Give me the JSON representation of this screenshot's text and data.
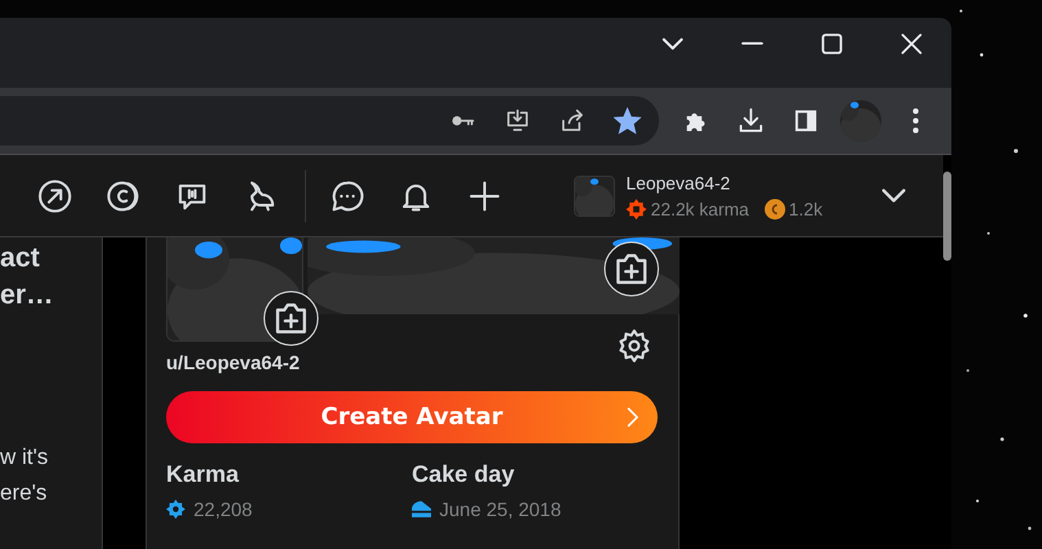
{
  "browser": {
    "bookmarked": true
  },
  "reddit_header": {
    "username": "Leopeva64-2",
    "karma": "22.2k karma",
    "coins": "1.2k"
  },
  "left_column": [
    {
      "text": "act",
      "kind": "title"
    },
    {
      "text": "er…",
      "kind": "title"
    },
    {
      "text": "w it's",
      "kind": "body"
    },
    {
      "text": "ere's",
      "kind": "body"
    }
  ],
  "profile_card": {
    "username": "u/Leopeva64-2",
    "button": "Create Avatar",
    "stats": [
      {
        "label": "Karma",
        "value": "22,208",
        "kind": "karma"
      },
      {
        "label": "Cake day",
        "value": "June 25, 2018",
        "kind": "cakeday"
      }
    ]
  }
}
